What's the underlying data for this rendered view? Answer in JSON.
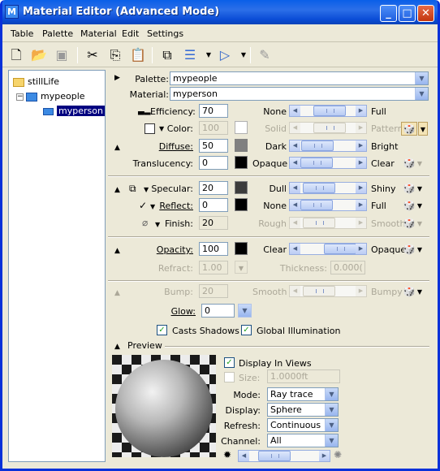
{
  "window": {
    "title": "Material Editor (Advanced Mode)",
    "icon": "material-app-icon",
    "min_glyph": "_",
    "max_glyph": "□",
    "close_glyph": "✕"
  },
  "menu": [
    "Table",
    "Palette",
    "Material",
    "Edit",
    "Settings"
  ],
  "toolbar_icons": [
    "new-icon",
    "open-folder-icon",
    "save-icon",
    "cut-icon",
    "copy-icon",
    "paste-icon",
    "assign-icon",
    "layers-icon",
    "pointer-icon",
    "edit-pen-icon"
  ],
  "tree": {
    "root": "stillLife",
    "child": "mypeople",
    "selected": "myperson"
  },
  "palette": {
    "label": "Palette:",
    "value": "mypeople"
  },
  "material": {
    "label": "Material:",
    "value": "myperson"
  },
  "efficiency": {
    "label": "Efficiency:",
    "value": "70",
    "min": "None",
    "max": "Full"
  },
  "color": {
    "label": "Color:",
    "value": "100",
    "min": "Solid",
    "max": "Pattern"
  },
  "diffuse": {
    "label": "Diffuse:",
    "value": "50",
    "min": "Dark",
    "max": "Bright"
  },
  "translucency": {
    "label": "Translucency:",
    "value": "0",
    "min": "Opaque",
    "max": "Clear"
  },
  "specular": {
    "label": "Specular:",
    "value": "20",
    "min": "Dull",
    "max": "Shiny"
  },
  "reflect": {
    "label": "Reflect:",
    "value": "0",
    "min": "None",
    "max": "Full"
  },
  "finish": {
    "label": "Finish:",
    "value": "20",
    "min": "Rough",
    "max": "Smooth"
  },
  "opacity": {
    "label": "Opacity:",
    "value": "100",
    "min": "Clear",
    "max": "Opaque"
  },
  "refract": {
    "label": "Refract:",
    "value": "1.00"
  },
  "thickness": {
    "label": "Thickness:",
    "value": "0.000("
  },
  "bump": {
    "label": "Bump:",
    "value": "20",
    "min": "Smooth",
    "max": "Bumpy"
  },
  "glow": {
    "label": "Glow:",
    "value": "0"
  },
  "casts_shadows": {
    "label": "Casts Shadows",
    "checked": true
  },
  "global_illumination": {
    "label": "Global Illumination",
    "checked": true
  },
  "preview": {
    "label": "Preview",
    "display_in_views": {
      "label": "Display In Views",
      "checked": true
    },
    "size": {
      "label": "Size:",
      "value": "1.0000ft"
    },
    "mode": {
      "label": "Mode:",
      "value": "Ray trace"
    },
    "display": {
      "label": "Display:",
      "value": "Sphere"
    },
    "refresh": {
      "label": "Refresh:",
      "value": "Continuous"
    },
    "channel": {
      "label": "Channel:",
      "value": "All"
    }
  },
  "colors": {
    "titlebar": "#0a5fe8",
    "swatch_color": "#ffffff",
    "swatch_diffuse": "#808080",
    "swatch_black": "#000000",
    "swatch_specular": "#3c3c3c"
  }
}
